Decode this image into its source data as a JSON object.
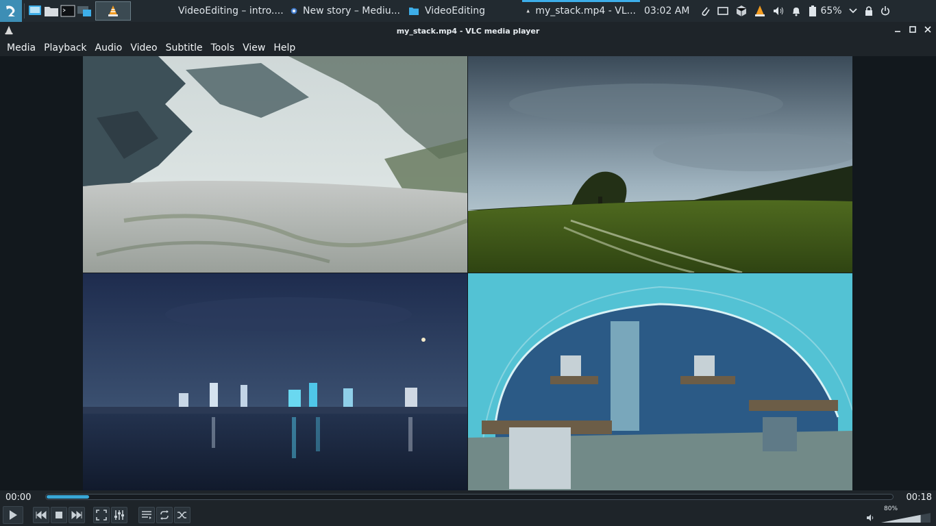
{
  "panel": {
    "tasks": [
      {
        "title": "VideoEditing – intro...."
      },
      {
        "title": "New story – Mediu..."
      },
      {
        "title": "VideoEditing"
      },
      {
        "title": "my_stack.mp4 - VL..."
      }
    ],
    "clock": "03:02 AM",
    "battery": "65%",
    "accent": "#3daee9"
  },
  "window": {
    "title": "my_stack.mp4 - VLC media player"
  },
  "menu": [
    "Media",
    "Playback",
    "Audio",
    "Video",
    "Subtitle",
    "Tools",
    "View",
    "Help"
  ],
  "playback": {
    "elapsed": "00:00",
    "total": "00:18",
    "progress_fraction": 0.05,
    "volume": "80%",
    "volume_fraction": 0.8
  },
  "icons": {
    "panel": [
      "kde-menu-icon",
      "desktop-icon",
      "folder-icon",
      "terminal-icon",
      "display-icon",
      "vlc-cone-icon"
    ],
    "tray": [
      "paperclip-icon",
      "media-icon",
      "package-icon",
      "vlc-tray-icon",
      "volume-icon",
      "bell-icon",
      "battery-icon",
      "chevron-down-icon",
      "lock-icon",
      "power-icon"
    ],
    "controls": [
      "play-icon",
      "previous-icon",
      "stop-icon",
      "next-icon",
      "fullscreen-icon",
      "equalizer-icon",
      "playlist-icon",
      "loop-icon",
      "shuffle-icon",
      "speaker-icon"
    ]
  }
}
